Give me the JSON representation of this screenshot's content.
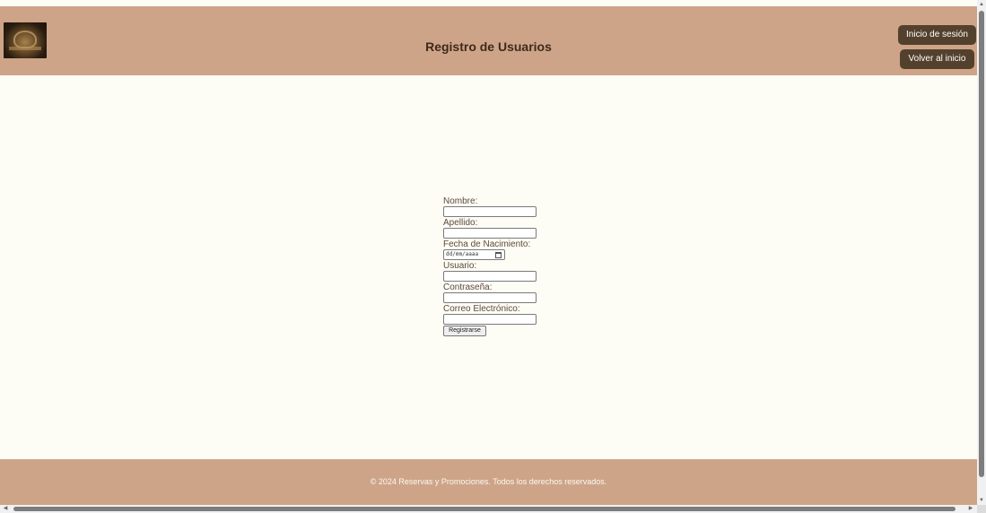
{
  "header": {
    "title": "Registro de Usuarios",
    "login_label": "Inicio de sesión",
    "home_label": "Volver al inicio"
  },
  "form": {
    "nombre_label": "Nombre:",
    "apellido_label": "Apellido:",
    "fecha_label": "Fecha de Nacimiento:",
    "fecha_placeholder": "dd/mm/aaaa",
    "usuario_label": "Usuario:",
    "contrasena_label": "Contraseña:",
    "correo_label": "Correo Electrónico:",
    "submit_label": "Registrarse"
  },
  "footer": {
    "text": "© 2024 Reservas y Promociones. Todos los derechos reservados."
  },
  "scrollbars": {
    "up_arrow": "▲",
    "down_arrow": "▼",
    "left_arrow": "◀",
    "right_arrow": "▶"
  },
  "colors": {
    "header_bg": "#cea488",
    "button_bg": "#53412d",
    "page_bg": "#fdfcf5"
  },
  "icons": {
    "logo": "logo-image",
    "calendar": "calendar-icon"
  }
}
